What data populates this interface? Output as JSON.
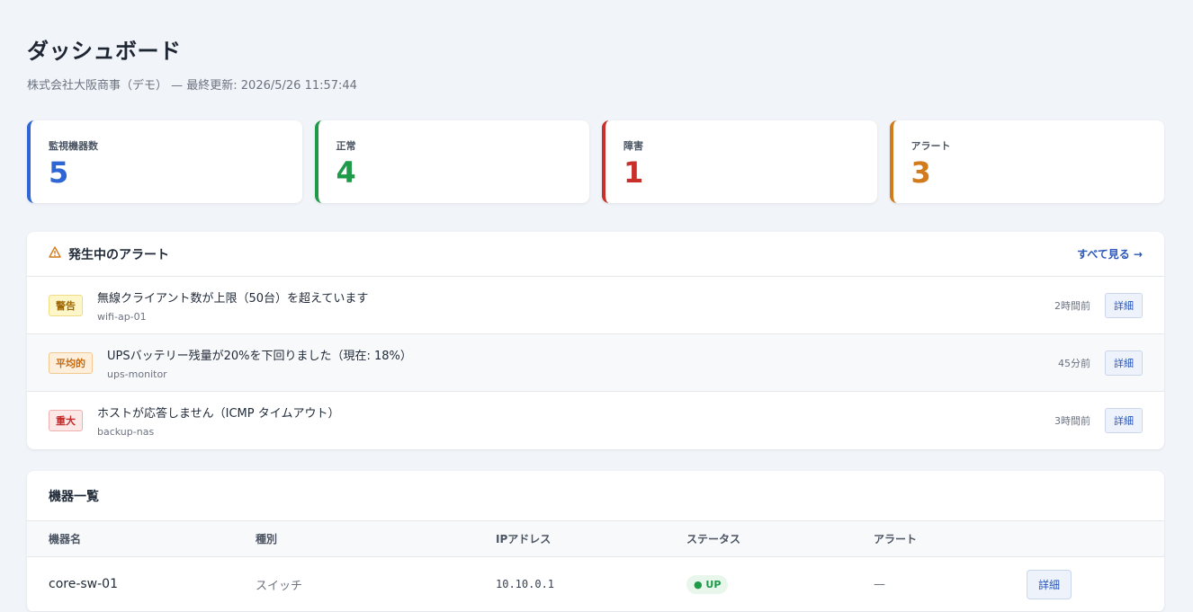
{
  "header": {
    "title": "ダッシュボード",
    "subtitle": "株式会社大阪商事（デモ） — 最終更新: 2026/5/26 11:57:44"
  },
  "stats": [
    {
      "label": "監視機器数",
      "value": "5",
      "color": "#2f66d4"
    },
    {
      "label": "正常",
      "value": "4",
      "color": "#1e9a48"
    },
    {
      "label": "障害",
      "value": "1",
      "color": "#c9302c"
    },
    {
      "label": "アラート",
      "value": "3",
      "color": "#d27b1c"
    }
  ],
  "alerts_panel": {
    "title": "発生中のアラート",
    "view_all": "すべて見る →",
    "items": [
      {
        "severity": "警告",
        "message": "無線クライアント数が上限（50台）を超えています",
        "host": "wifi-ap-01",
        "time": "2時間前",
        "action": "詳細"
      },
      {
        "severity": "平均的",
        "message": "UPSバッテリー残量が20%を下回りました（現在: 18%）",
        "host": "ups-monitor",
        "time": "45分前",
        "action": "詳細"
      },
      {
        "severity": "重大",
        "message": "ホストが応答しません（ICMP タイムアウト）",
        "host": "backup-nas",
        "time": "3時間前",
        "action": "詳細"
      }
    ]
  },
  "devices_panel": {
    "title": "機器一覧",
    "columns": [
      "機器名",
      "種別",
      "IPアドレス",
      "ステータス",
      "アラート"
    ],
    "rows": [
      {
        "name": "core-sw-01",
        "type": "スイッチ",
        "ip": "10.10.0.1",
        "status": "● UP",
        "alert": "—",
        "action": "詳細"
      }
    ]
  }
}
